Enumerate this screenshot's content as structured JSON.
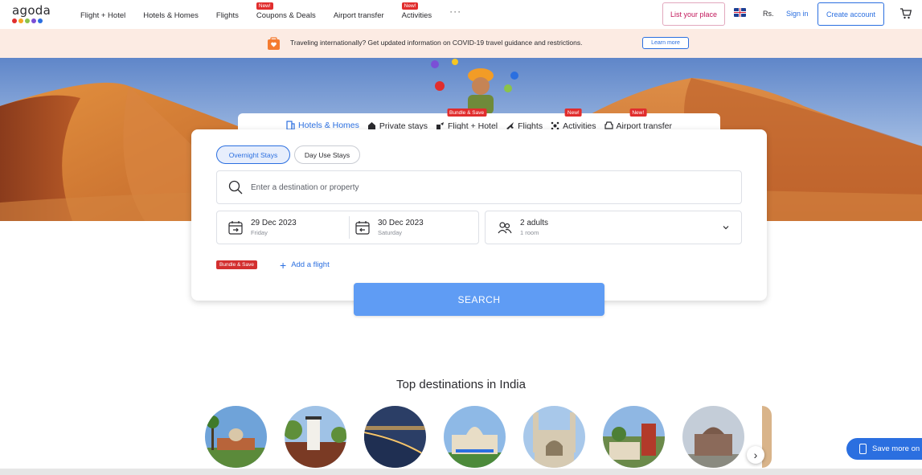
{
  "nav": {
    "logo": "agoda",
    "logo_dot_colors": [
      "#e12d2d",
      "#f5a623",
      "#8bc34a",
      "#7b4fd6",
      "#2b6fe0"
    ],
    "links": [
      {
        "label": "Flight + Hotel",
        "tag": ""
      },
      {
        "label": "Hotels & Homes",
        "tag": ""
      },
      {
        "label": "Flights",
        "tag": ""
      },
      {
        "label": "Coupons & Deals",
        "tag": "New!"
      },
      {
        "label": "Airport transfer",
        "tag": ""
      },
      {
        "label": "Activities",
        "tag": "New!"
      }
    ],
    "more": "···",
    "list_place": "List your place",
    "currency": "Rs.",
    "sign_in": "Sign in",
    "create_account": "Create account"
  },
  "banner": {
    "text": "Traveling internationally? Get updated information on COVID-19 travel guidance and restrictions.",
    "learn_more": "Learn more"
  },
  "search": {
    "tabs": [
      {
        "label": "Hotels & Homes",
        "tag": "",
        "active": true,
        "icon": "building-icon"
      },
      {
        "label": "Private stays",
        "tag": "",
        "active": false,
        "icon": "house-icon"
      },
      {
        "label": "Flight + Hotel",
        "tag": "Bundle & Save",
        "active": false,
        "icon": "flight-hotel-icon"
      },
      {
        "label": "Flights",
        "tag": "",
        "active": false,
        "icon": "plane-icon"
      },
      {
        "label": "Activities",
        "tag": "New!",
        "active": false,
        "icon": "activities-icon"
      },
      {
        "label": "Airport transfer",
        "tag": "New!",
        "active": false,
        "icon": "car-icon"
      }
    ],
    "stay_types": {
      "overnight": "Overnight Stays",
      "day_use": "Day Use Stays"
    },
    "destination_placeholder": "Enter a destination or property",
    "checkin": {
      "date": "29 Dec 2023",
      "day": "Friday"
    },
    "checkout": {
      "date": "30 Dec 2023",
      "day": "Saturday"
    },
    "guests": {
      "adults": "2 adults",
      "rooms": "1 room"
    },
    "bundle_tag": "Bundle & Save",
    "add_flight": "Add a flight",
    "button": "SEARCH"
  },
  "destinations": {
    "title": "Top destinations in India",
    "items": [
      "destination-1",
      "destination-2",
      "destination-3",
      "destination-4",
      "destination-5",
      "destination-6",
      "destination-7",
      "destination-8"
    ]
  },
  "save_more": "Save more on",
  "colors": {
    "accent": "#2b6fe0",
    "search_button": "#5f9cf4",
    "tag_red": "#e12d2d",
    "banner_bg": "#fcebe3"
  }
}
